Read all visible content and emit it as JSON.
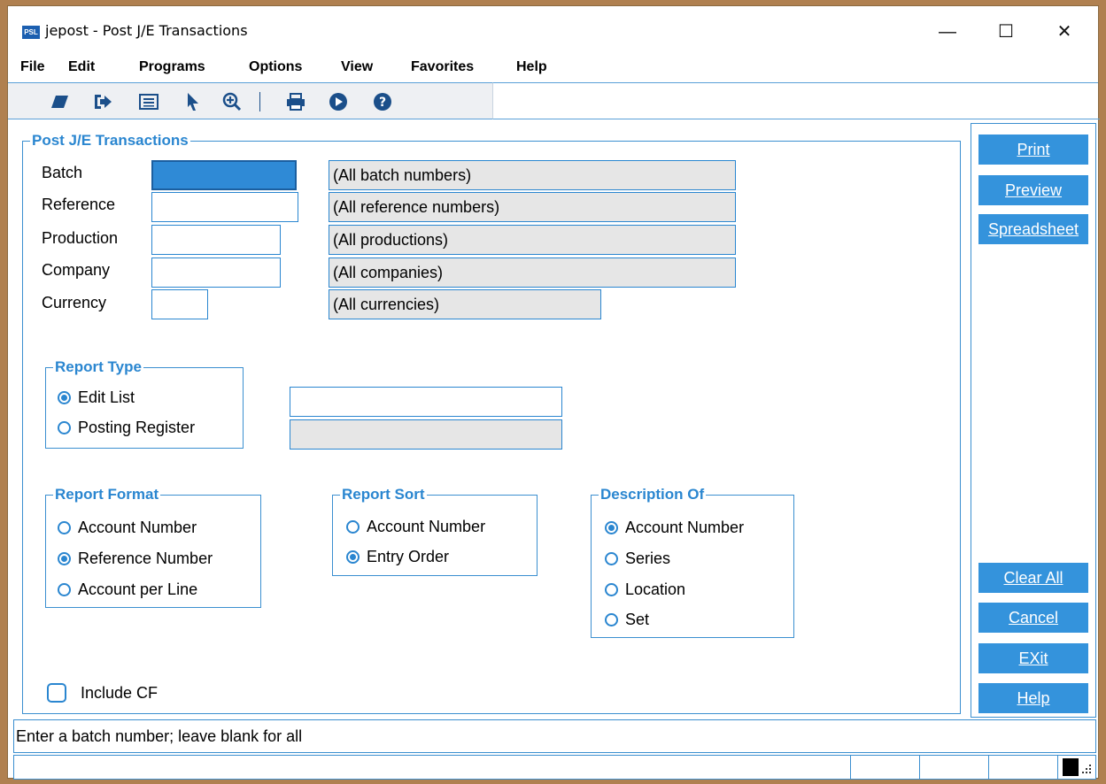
{
  "window": {
    "icon_text": "PSL",
    "title": "jepost - Post J/E Transactions",
    "minimize_glyph": "—",
    "maximize_glyph": "☐",
    "close_glyph": "✕"
  },
  "menu": [
    "File",
    "Edit",
    "Programs",
    "Options",
    "View",
    "Favorites",
    "Help"
  ],
  "toolbar": {
    "icons": [
      "eraser-icon",
      "exit-arrow-icon",
      "list-view-icon",
      "pointer-icon",
      "zoom-in-icon",
      "print-icon",
      "play-icon",
      "help-icon"
    ]
  },
  "form": {
    "group_title": "Post J/E Transactions",
    "fields": [
      {
        "label": "Batch",
        "value": "",
        "description": "(All batch numbers)"
      },
      {
        "label": "Reference",
        "value": "",
        "description": "(All reference numbers)"
      },
      {
        "label": "Production",
        "value": "",
        "description": "(All productions)"
      },
      {
        "label": "Company",
        "value": "",
        "description": "(All companies)"
      },
      {
        "label": "Currency",
        "value": "",
        "description": "(All currencies)"
      }
    ],
    "report_type": {
      "title": "Report Type",
      "options": [
        "Edit List",
        "Posting Register"
      ],
      "selected": "Edit List",
      "extra_field_value": "",
      "extra_readonly_value": ""
    },
    "report_format": {
      "title": "Report Format",
      "options": [
        "Account Number",
        "Reference Number",
        "Account per Line"
      ],
      "selected": "Reference Number"
    },
    "report_sort": {
      "title": "Report Sort",
      "options": [
        "Account Number",
        "Entry Order"
      ],
      "selected": "Entry Order"
    },
    "description_of": {
      "title": "Description Of",
      "options": [
        "Account Number",
        "Series",
        "Location",
        "Set"
      ],
      "selected": "Account Number"
    },
    "include_cf": {
      "label": "Include CF",
      "checked": false
    }
  },
  "sidebar": {
    "print": "Print",
    "preview": "Preview",
    "spreadsheet": "Spreadsheet",
    "clear_all": "Clear All",
    "cancel": "Cancel",
    "exit": "EXit",
    "help": "Help"
  },
  "status": {
    "message": "Enter a batch number; leave blank for all"
  },
  "colors": {
    "accent": "#2a86d0",
    "button": "#3493dc",
    "readonly": "#e6e6e6",
    "frame": "#b08050"
  }
}
